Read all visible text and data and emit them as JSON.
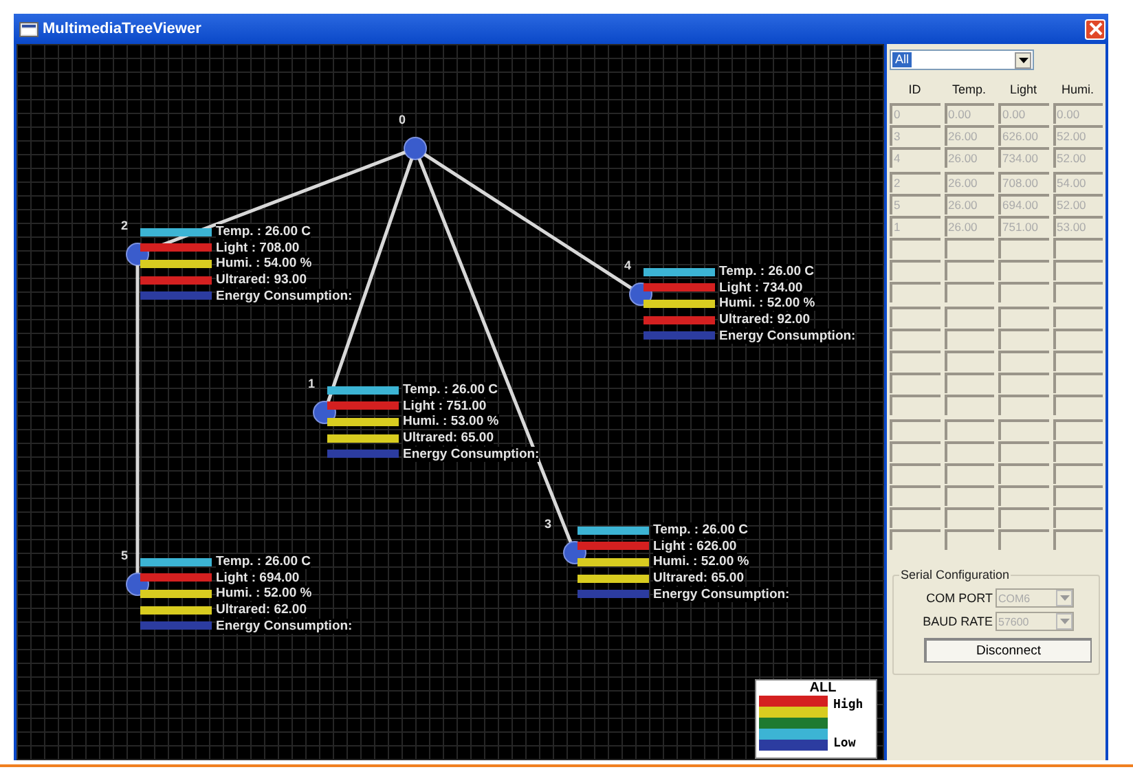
{
  "window": {
    "title": "MultimediaTreeViewer"
  },
  "tree": {
    "id": "0",
    "children": [
      {
        "id": "2",
        "readings": [
          {
            "text": "Temp. : 26.00 C",
            "color": "#3cb4d4"
          },
          {
            "text": "Light : 708.00",
            "color": "#d42020"
          },
          {
            "text": "Humi. : 54.00 %",
            "color": "#d8cc20"
          },
          {
            "text": "Ultrared: 93.00",
            "color": "#d42020"
          },
          {
            "text": "Energy Consumption:",
            "color": "#2c3ca0"
          }
        ],
        "children": [
          {
            "id": "5",
            "readings": [
              {
                "text": "Temp. : 26.00 C",
                "color": "#3cb4d4"
              },
              {
                "text": "Light : 694.00",
                "color": "#d42020"
              },
              {
                "text": "Humi. : 52.00 %",
                "color": "#d8cc20"
              },
              {
                "text": "Ultrared: 62.00",
                "color": "#d8cc20"
              },
              {
                "text": "Energy Consumption:",
                "color": "#2c3ca0"
              }
            ]
          }
        ]
      },
      {
        "id": "1",
        "readings": [
          {
            "text": "Temp. : 26.00 C",
            "color": "#3cb4d4"
          },
          {
            "text": "Light : 751.00",
            "color": "#d42020"
          },
          {
            "text": "Humi. : 53.00 %",
            "color": "#d8cc20"
          },
          {
            "text": "Ultrared: 65.00",
            "color": "#d8cc20"
          },
          {
            "text": "Energy Consumption:",
            "color": "#2c3ca0"
          }
        ]
      },
      {
        "id": "3",
        "readings": [
          {
            "text": "Temp. : 26.00 C",
            "color": "#3cb4d4"
          },
          {
            "text": "Light : 626.00",
            "color": "#d42020"
          },
          {
            "text": "Humi. : 52.00 %",
            "color": "#d8cc20"
          },
          {
            "text": "Ultrared: 65.00",
            "color": "#d8cc20"
          },
          {
            "text": "Energy Consumption:",
            "color": "#2c3ca0"
          }
        ]
      },
      {
        "id": "4",
        "readings": [
          {
            "text": "Temp. : 26.00 C",
            "color": "#3cb4d4"
          },
          {
            "text": "Light : 734.00",
            "color": "#d42020"
          },
          {
            "text": "Humi. : 52.00 %",
            "color": "#d8cc20"
          },
          {
            "text": "Ultrared: 92.00",
            "color": "#d42020"
          },
          {
            "text": "Energy Consumption:",
            "color": "#2c3ca0"
          }
        ]
      }
    ]
  },
  "legend": {
    "title": "ALL",
    "high_label": "High",
    "low_label": "Low",
    "bands": [
      {
        "color": "#d42020"
      },
      {
        "color": "#d8cc20"
      },
      {
        "color": "#1e7a30"
      },
      {
        "color": "#3cb4d4"
      },
      {
        "color": "#2c3ca0"
      }
    ]
  },
  "filter": {
    "value": "All"
  },
  "table": {
    "columns": [
      "ID",
      "Temp.",
      "Light",
      "Humi."
    ],
    "rows": [
      [
        "0",
        "0.00",
        "0.00",
        "0.00"
      ],
      [
        "3",
        "26.00",
        "626.00",
        "52.00"
      ],
      [
        "4",
        "26.00",
        "734.00",
        "52.00"
      ],
      [
        "2",
        "26.00",
        "708.00",
        "54.00"
      ],
      [
        "5",
        "26.00",
        "694.00",
        "52.00"
      ],
      [
        "1",
        "26.00",
        "751.00",
        "53.00"
      ]
    ]
  },
  "serial": {
    "title": "Serial Configuration",
    "fields": [
      {
        "label": "COM PORT",
        "value": "COM6",
        "disabled": true
      },
      {
        "label": "BAUD RATE",
        "value": "57600",
        "disabled": true
      }
    ],
    "button": "Disconnect"
  }
}
